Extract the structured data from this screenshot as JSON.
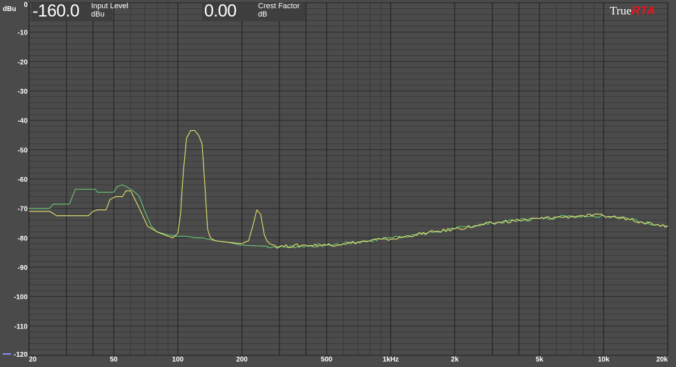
{
  "readouts": {
    "input_level_value": "-160.0",
    "input_level_label": "Input Level",
    "input_level_unit": "dBu",
    "crest_factor_value": "0.00",
    "crest_factor_label": "Crest Factor",
    "crest_factor_unit": "dB"
  },
  "brand": {
    "part1": "True",
    "part2": "RTA"
  },
  "colors": {
    "background": "#4a4a4a",
    "plot_background": "#4b4b4b",
    "grid_major": "#2a2a2a",
    "grid_minor": "#3a3a3a",
    "series_green": "#66cc77",
    "series_yellow": "#e6e66e",
    "brand_accent": "#e8141c"
  },
  "chart_data": {
    "type": "line",
    "title": "",
    "xlabel": "",
    "ylabel": "dBu",
    "x_scale": "log",
    "xlim": [
      20,
      20000
    ],
    "ylim": [
      -120,
      0
    ],
    "grid": true,
    "x_ticks": [
      {
        "value": 20,
        "label": "20"
      },
      {
        "value": 50,
        "label": "50"
      },
      {
        "value": 100,
        "label": "100"
      },
      {
        "value": 200,
        "label": "200"
      },
      {
        "value": 500,
        "label": "500"
      },
      {
        "value": 1000,
        "label": "1kHz"
      },
      {
        "value": 2000,
        "label": "2k"
      },
      {
        "value": 5000,
        "label": "5k"
      },
      {
        "value": 10000,
        "label": "10k"
      },
      {
        "value": 20000,
        "label": "20k"
      }
    ],
    "y_ticks": [
      {
        "value": 0,
        "label": "0"
      },
      {
        "value": -10,
        "label": "-10"
      },
      {
        "value": -20,
        "label": "-20"
      },
      {
        "value": -30,
        "label": "-30"
      },
      {
        "value": -40,
        "label": "-40"
      },
      {
        "value": -50,
        "label": "-50"
      },
      {
        "value": -60,
        "label": "-60"
      },
      {
        "value": -70,
        "label": "-70"
      },
      {
        "value": -80,
        "label": "-80"
      },
      {
        "value": -90,
        "label": "-90"
      },
      {
        "value": -100,
        "label": "-100"
      },
      {
        "value": -110,
        "label": "-110"
      },
      {
        "value": -120,
        "label": "-120"
      }
    ],
    "series": [
      {
        "color": "#66cc77",
        "points": [
          [
            20,
            -70
          ],
          [
            25,
            -70
          ],
          [
            26,
            -68.5
          ],
          [
            31,
            -68.5
          ],
          [
            33,
            -63.5
          ],
          [
            41,
            -63.5
          ],
          [
            42,
            -64.5
          ],
          [
            50,
            -64.5
          ],
          [
            52,
            -62.5
          ],
          [
            55,
            -62
          ],
          [
            58,
            -62.8
          ],
          [
            60,
            -63.5
          ],
          [
            63,
            -64.5
          ],
          [
            66,
            -66
          ],
          [
            70,
            -71
          ],
          [
            75,
            -76
          ],
          [
            80,
            -78
          ],
          [
            90,
            -79
          ],
          [
            100,
            -79.5
          ],
          [
            110,
            -79.5
          ],
          [
            120,
            -80
          ],
          [
            130,
            -80
          ],
          [
            150,
            -81
          ],
          [
            170,
            -81.5
          ],
          [
            200,
            -82.5
          ],
          [
            250,
            -82.8
          ],
          [
            300,
            -83.2
          ],
          [
            400,
            -82.8
          ],
          [
            500,
            -82.5
          ],
          [
            600,
            -82
          ],
          [
            700,
            -81.5
          ],
          [
            800,
            -81
          ],
          [
            900,
            -80.5
          ],
          [
            1000,
            -80
          ],
          [
            1300,
            -79
          ],
          [
            1600,
            -78
          ],
          [
            2000,
            -77
          ],
          [
            2500,
            -75.8
          ],
          [
            3000,
            -75
          ],
          [
            4000,
            -74
          ],
          [
            5000,
            -73.5
          ],
          [
            6000,
            -73
          ],
          [
            7000,
            -72.5
          ],
          [
            8000,
            -72.5
          ],
          [
            10000,
            -72.5
          ],
          [
            11000,
            -72.8
          ],
          [
            13000,
            -73.5
          ],
          [
            15000,
            -74.5
          ],
          [
            18000,
            -75.5
          ],
          [
            20000,
            -76
          ]
        ]
      },
      {
        "color": "#e6e66e",
        "points": [
          [
            20,
            -71
          ],
          [
            25,
            -71
          ],
          [
            27,
            -72.5
          ],
          [
            38,
            -72.5
          ],
          [
            40,
            -71
          ],
          [
            42,
            -70.5
          ],
          [
            46,
            -70.5
          ],
          [
            48,
            -67
          ],
          [
            51,
            -66
          ],
          [
            55,
            -66
          ],
          [
            57,
            -64
          ],
          [
            60,
            -64
          ],
          [
            62,
            -66
          ],
          [
            65,
            -69
          ],
          [
            68,
            -72
          ],
          [
            72,
            -76
          ],
          [
            80,
            -78
          ],
          [
            90,
            -79.5
          ],
          [
            95,
            -80
          ],
          [
            100,
            -78.5
          ],
          [
            103,
            -72
          ],
          [
            106,
            -58
          ],
          [
            110,
            -46
          ],
          [
            115,
            -43.5
          ],
          [
            120,
            -43.5
          ],
          [
            125,
            -45
          ],
          [
            130,
            -48
          ],
          [
            134,
            -62
          ],
          [
            138,
            -77
          ],
          [
            142,
            -80
          ],
          [
            150,
            -81
          ],
          [
            170,
            -81.5
          ],
          [
            200,
            -82
          ],
          [
            215,
            -81
          ],
          [
            225,
            -76
          ],
          [
            235,
            -70.5
          ],
          [
            245,
            -72
          ],
          [
            255,
            -79
          ],
          [
            270,
            -82
          ],
          [
            300,
            -83
          ],
          [
            400,
            -82.5
          ],
          [
            500,
            -82.5
          ],
          [
            600,
            -82
          ],
          [
            700,
            -81.5
          ],
          [
            800,
            -81
          ],
          [
            900,
            -80.5
          ],
          [
            1000,
            -80.5
          ],
          [
            1300,
            -79
          ],
          [
            1600,
            -78
          ],
          [
            2000,
            -77
          ],
          [
            2500,
            -76
          ],
          [
            3000,
            -75
          ],
          [
            4000,
            -74
          ],
          [
            5000,
            -73.5
          ],
          [
            6000,
            -73
          ],
          [
            7000,
            -72.8
          ],
          [
            8000,
            -72.5
          ],
          [
            10000,
            -72.5
          ],
          [
            11000,
            -72.8
          ],
          [
            13000,
            -73.5
          ],
          [
            15000,
            -74.5
          ],
          [
            18000,
            -75.5
          ],
          [
            20000,
            -76
          ]
        ]
      }
    ]
  }
}
